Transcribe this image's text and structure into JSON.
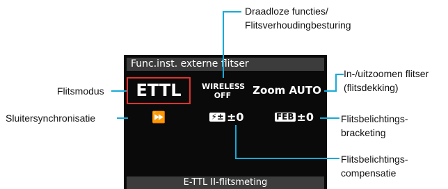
{
  "screen": {
    "title": "Func.inst. externe flitser",
    "flash_mode": "ETTL",
    "wireless": {
      "line1": "WIRELESS",
      "line2": "OFF"
    },
    "zoom": "Zoom AUTO",
    "sync_icon": "high-speed-sync-icon",
    "sync_glyph": "⏩",
    "fec": {
      "badge": "±",
      "icon": "flash-exposure-compensation-icon",
      "value": "±0"
    },
    "feb": {
      "badge": "FEB",
      "value": "±0"
    },
    "footer": "E-TTL II-flitsmeting"
  },
  "callouts": {
    "wireless_line1": "Draadloze functies/",
    "wireless_line2": "Flitsverhoudingbesturing",
    "flash_mode": "Flitsmodus",
    "zoom_line1": "In-/uitzoomen flitser",
    "zoom_line2": "(flitsdekking)",
    "sync": "Sluitersynchronisatie",
    "feb_line1": "Flitsbelichtings-",
    "feb_line2": "bracketing",
    "fec_line1": "Flitsbelichtings-",
    "fec_line2": "compensatie"
  },
  "colors": {
    "accent": "#17a9d8",
    "selected_border": "#e2312b",
    "lcd_bg": "#0a0a0a",
    "bar_bg": "#3c3c3c"
  }
}
